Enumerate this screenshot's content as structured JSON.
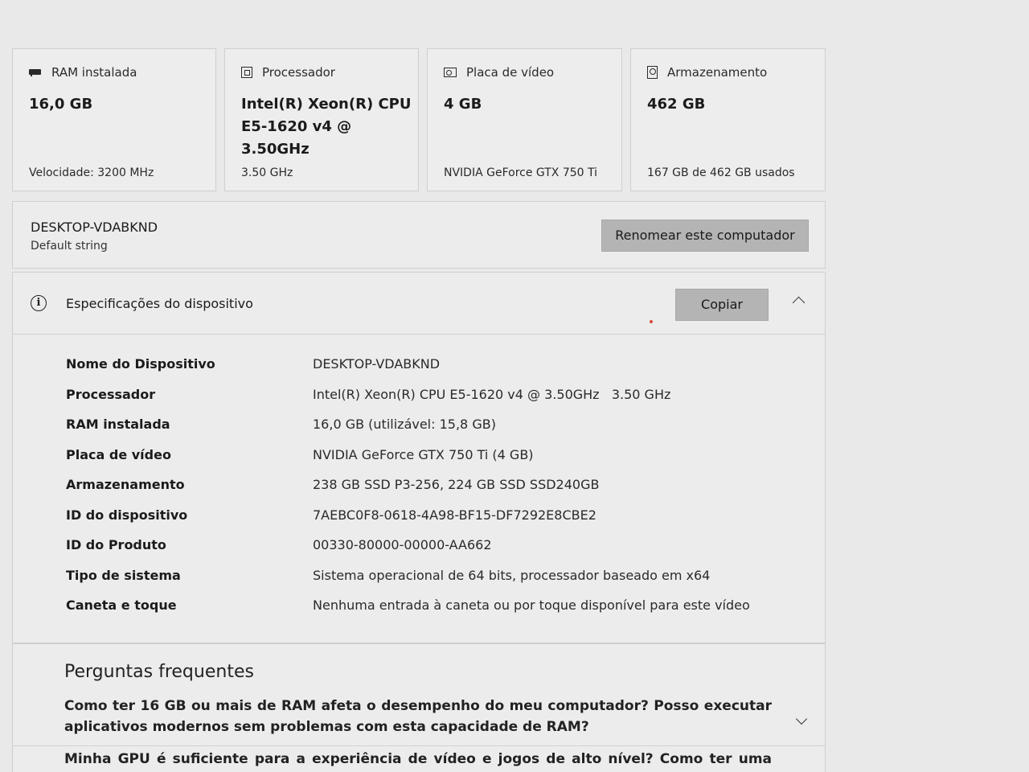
{
  "cards": [
    {
      "icon": "ram-icon",
      "label": "RAM instalada",
      "value": "16,0 GB",
      "sub": "Velocidade: 3200 MHz"
    },
    {
      "icon": "processor-icon",
      "label": "Processador",
      "value": "Intel(R) Xeon(R) CPU E5-1620 v4 @ 3.50GHz",
      "sub": "3.50 GHz"
    },
    {
      "icon": "gpu-icon",
      "label": "Placa de vídeo",
      "value": "4 GB",
      "sub": "NVIDIA GeForce GTX 750 Ti"
    },
    {
      "icon": "storage-icon",
      "label": "Armazenamento",
      "value": "462 GB",
      "sub": "167 GB de 462 GB usados"
    }
  ],
  "computer": {
    "name": "DESKTOP-VDABKND",
    "description": "Default string",
    "rename_label": "Renomear este computador"
  },
  "specs": {
    "title": "Especificações do dispositivo",
    "copy_label": "Copiar",
    "rows": [
      {
        "key": "Nome do Dispositivo",
        "value": "DESKTOP-VDABKND"
      },
      {
        "key": "Processador",
        "value": "Intel(R) Xeon(R) CPU E5-1620 v4 @ 3.50GHz   3.50 GHz"
      },
      {
        "key": "RAM instalada",
        "value": "16,0 GB (utilizável: 15,8 GB)"
      },
      {
        "key": "Placa de vídeo",
        "value": "NVIDIA GeForce GTX 750 Ti (4 GB)"
      },
      {
        "key": "Armazenamento",
        "value": "238 GB SSD P3-256, 224 GB SSD SSD240GB"
      },
      {
        "key": "ID do dispositivo",
        "value": "7AEBC0F8-0618-4A98-BF15-DF7292E8CBE2"
      },
      {
        "key": "ID do Produto",
        "value": "00330-80000-00000-AA662"
      },
      {
        "key": "Tipo de sistema",
        "value": "Sistema operacional de 64 bits, processador baseado em x64"
      },
      {
        "key": "Caneta e toque",
        "value": "Nenhuma entrada à caneta ou por toque disponível para este vídeo"
      }
    ]
  },
  "faq": {
    "title": "Perguntas frequentes",
    "q1": "Como ter 16 GB ou mais de RAM afeta o desempenho do meu computador? Posso executar aplicativos modernos sem problemas com esta capacidade de RAM?",
    "q2": "Minha GPU é suficiente para a experiência de vídeo e jogos de alto nível? Como ter uma GPU"
  }
}
